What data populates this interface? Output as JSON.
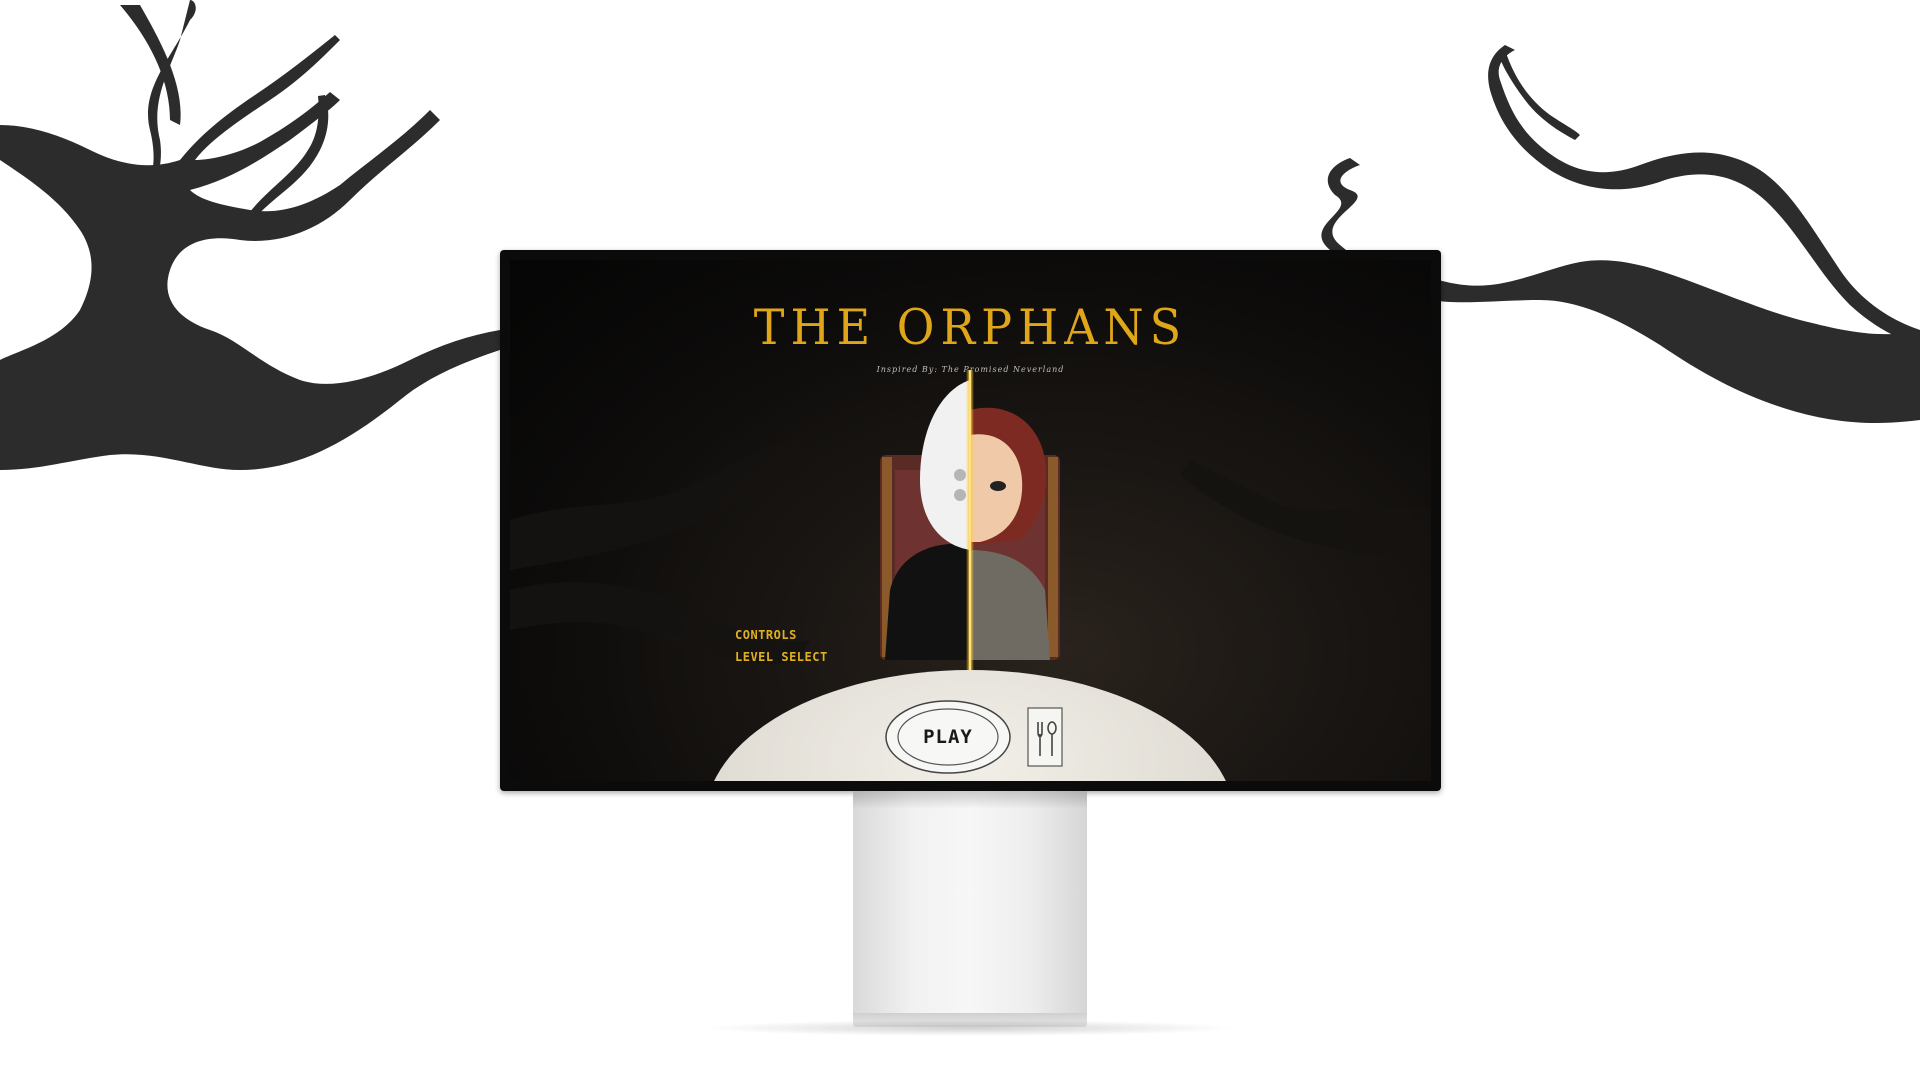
{
  "game": {
    "title": "THE ORPHANS",
    "subtitle": "Inspired By: The Promised Neverland"
  },
  "menu": {
    "items": [
      {
        "label": "CONTROLS"
      },
      {
        "label": "LEVEL SELECT"
      }
    ],
    "play_label": "PLAY"
  },
  "colors": {
    "title": "#e0a619",
    "menu_text": "#e0b022",
    "background": "#ffffff",
    "tree": "#2a2a2a"
  },
  "icons": {
    "plate": "plate-icon",
    "cutlery": "fork-spoon-icon"
  }
}
